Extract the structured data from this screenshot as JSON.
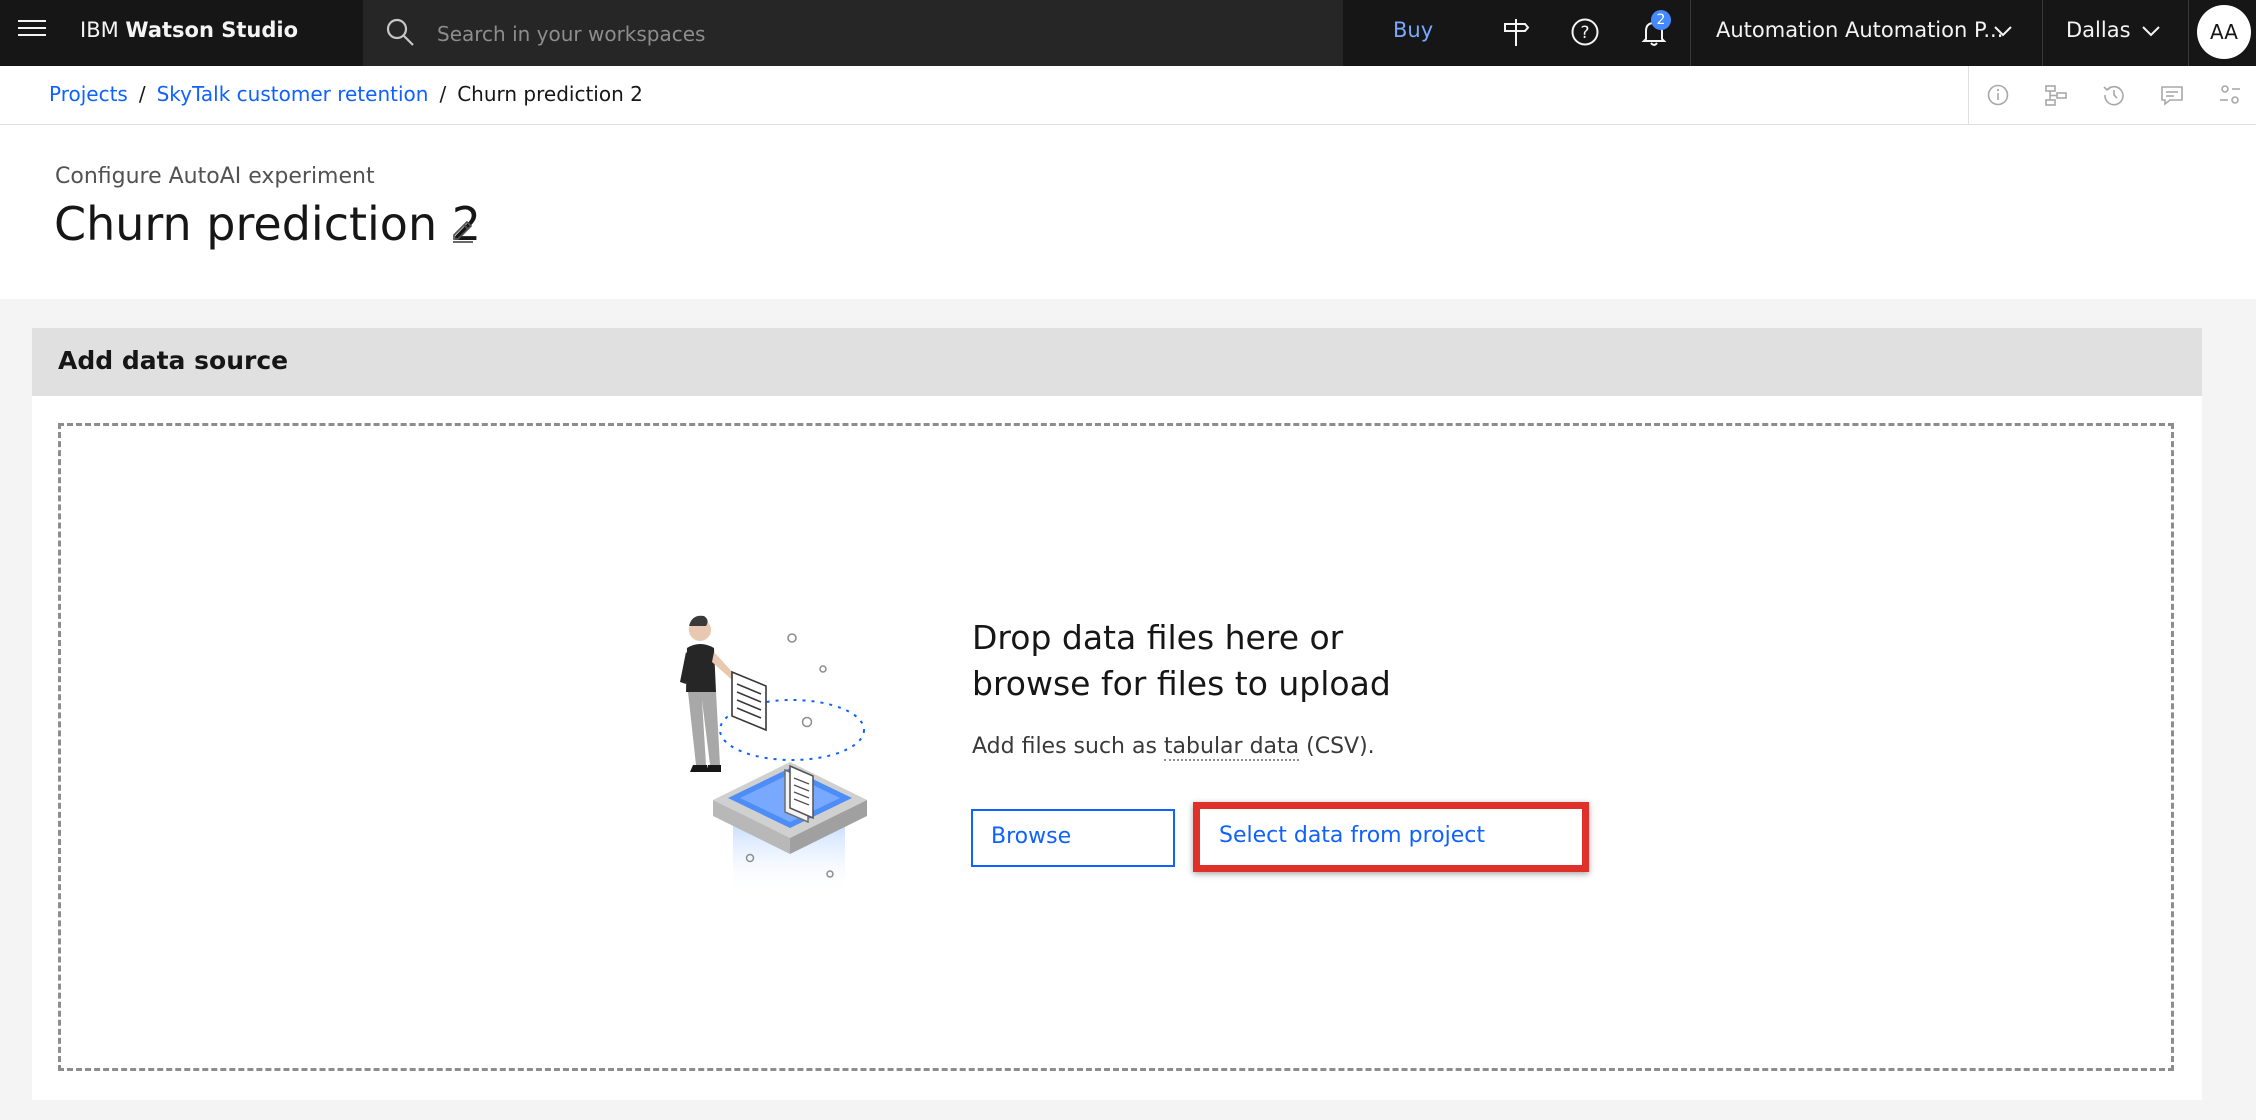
{
  "header": {
    "brand_prefix": "IBM",
    "brand_name": "Watson Studio",
    "search_placeholder": "Search in your workspaces",
    "buy_label": "Buy",
    "notification_count": "2",
    "account_label": "Automation Automation P...",
    "region_label": "Dallas",
    "avatar_initials": "AA",
    "icons": [
      "menu-icon",
      "search-icon",
      "signpost-icon",
      "help-icon",
      "notification-icon",
      "chevron-down-icon",
      "avatar"
    ]
  },
  "breadcrumb": {
    "items": [
      {
        "label": "Projects"
      },
      {
        "label": "SkyTalk customer retention"
      }
    ],
    "current": "Churn prediction 2",
    "tools": [
      "information-icon",
      "lineage-icon",
      "history-icon",
      "comment-icon",
      "settings-adjust-icon"
    ]
  },
  "page": {
    "subtitle": "Configure AutoAI experiment",
    "title": "Churn prediction 2"
  },
  "data_source": {
    "heading": "Add data source",
    "drop_line1": "Drop data files here or",
    "drop_line2": "browse for files to upload",
    "hint_prefix": "Add files such as ",
    "hint_term": "tabular data",
    "hint_suffix": " (CSV).",
    "browse_label": "Browse",
    "select_label": "Select data from project"
  },
  "colors": {
    "header_bg": "#161616",
    "link_blue": "#0f62fe",
    "highlight_red": "#e0302a",
    "panel_header_bg": "#e0e0e0"
  }
}
